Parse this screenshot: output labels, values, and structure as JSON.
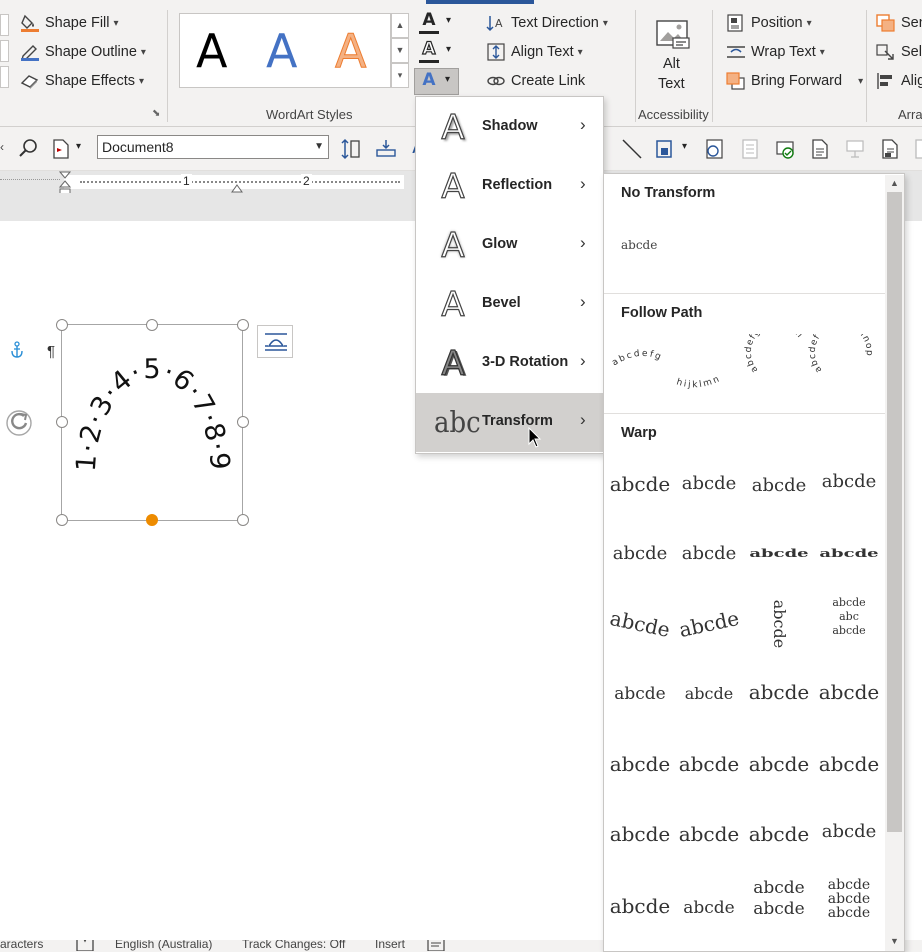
{
  "ribbon": {
    "shape_fill": "Shape Fill",
    "shape_outline": "Shape Outline",
    "shape_effects": "Shape Effects",
    "wordart_styles_label": "WordArt Styles",
    "wordart_glyph": "A",
    "text_direction": "Text Direction",
    "align_text": "Align Text",
    "create_link": "Create Link",
    "alt_text_line1": "Alt",
    "alt_text_line2": "Text",
    "accessibility_label": "Accessibility",
    "position": "Position",
    "wrap_text": "Wrap Text",
    "bring_forward": "Bring Forward",
    "send_partial": "Sen",
    "select_partial": "Sele",
    "align_partial": "Alig",
    "arrange_partial": "Arra"
  },
  "toolbar": {
    "document_name": "Document8"
  },
  "ruler": {
    "mark1": "1",
    "mark2": "2"
  },
  "shape": {
    "curved_text": "1·2·3·4·5·6·7·8·9"
  },
  "effects_menu": {
    "items": [
      {
        "label": "Shadow"
      },
      {
        "label": "Reflection"
      },
      {
        "label": "Glow"
      },
      {
        "label": "Bevel"
      },
      {
        "label": "3-D Rotation"
      },
      {
        "label": "Transform"
      }
    ],
    "active_item": "Transform"
  },
  "transform_gallery": {
    "no_transform_title": "No Transform",
    "no_transform_sample": "abcde",
    "follow_path_title": "Follow Path",
    "follow_path_samples": [
      "abcdefg",
      "hijklmn",
      "abcdefg hijklmn",
      "abcdef Ghij klmnop"
    ],
    "warp_title": "Warp",
    "warp_sample": "abcde",
    "warp_inner_sample": "abc"
  },
  "statusbar": {
    "characters_partial": "aracters",
    "language": "English (Australia)",
    "track_changes": "Track Changes: Off",
    "insert": "Insert"
  },
  "colors": {
    "accent_blue": "#2b579a",
    "wordart_blue": "#4472c4",
    "wordart_orange": "#f4b183",
    "fill_orange": "#ed7d31",
    "selection_handle_orange": "#ed8b00",
    "menu_active": "#d2d0ce"
  }
}
